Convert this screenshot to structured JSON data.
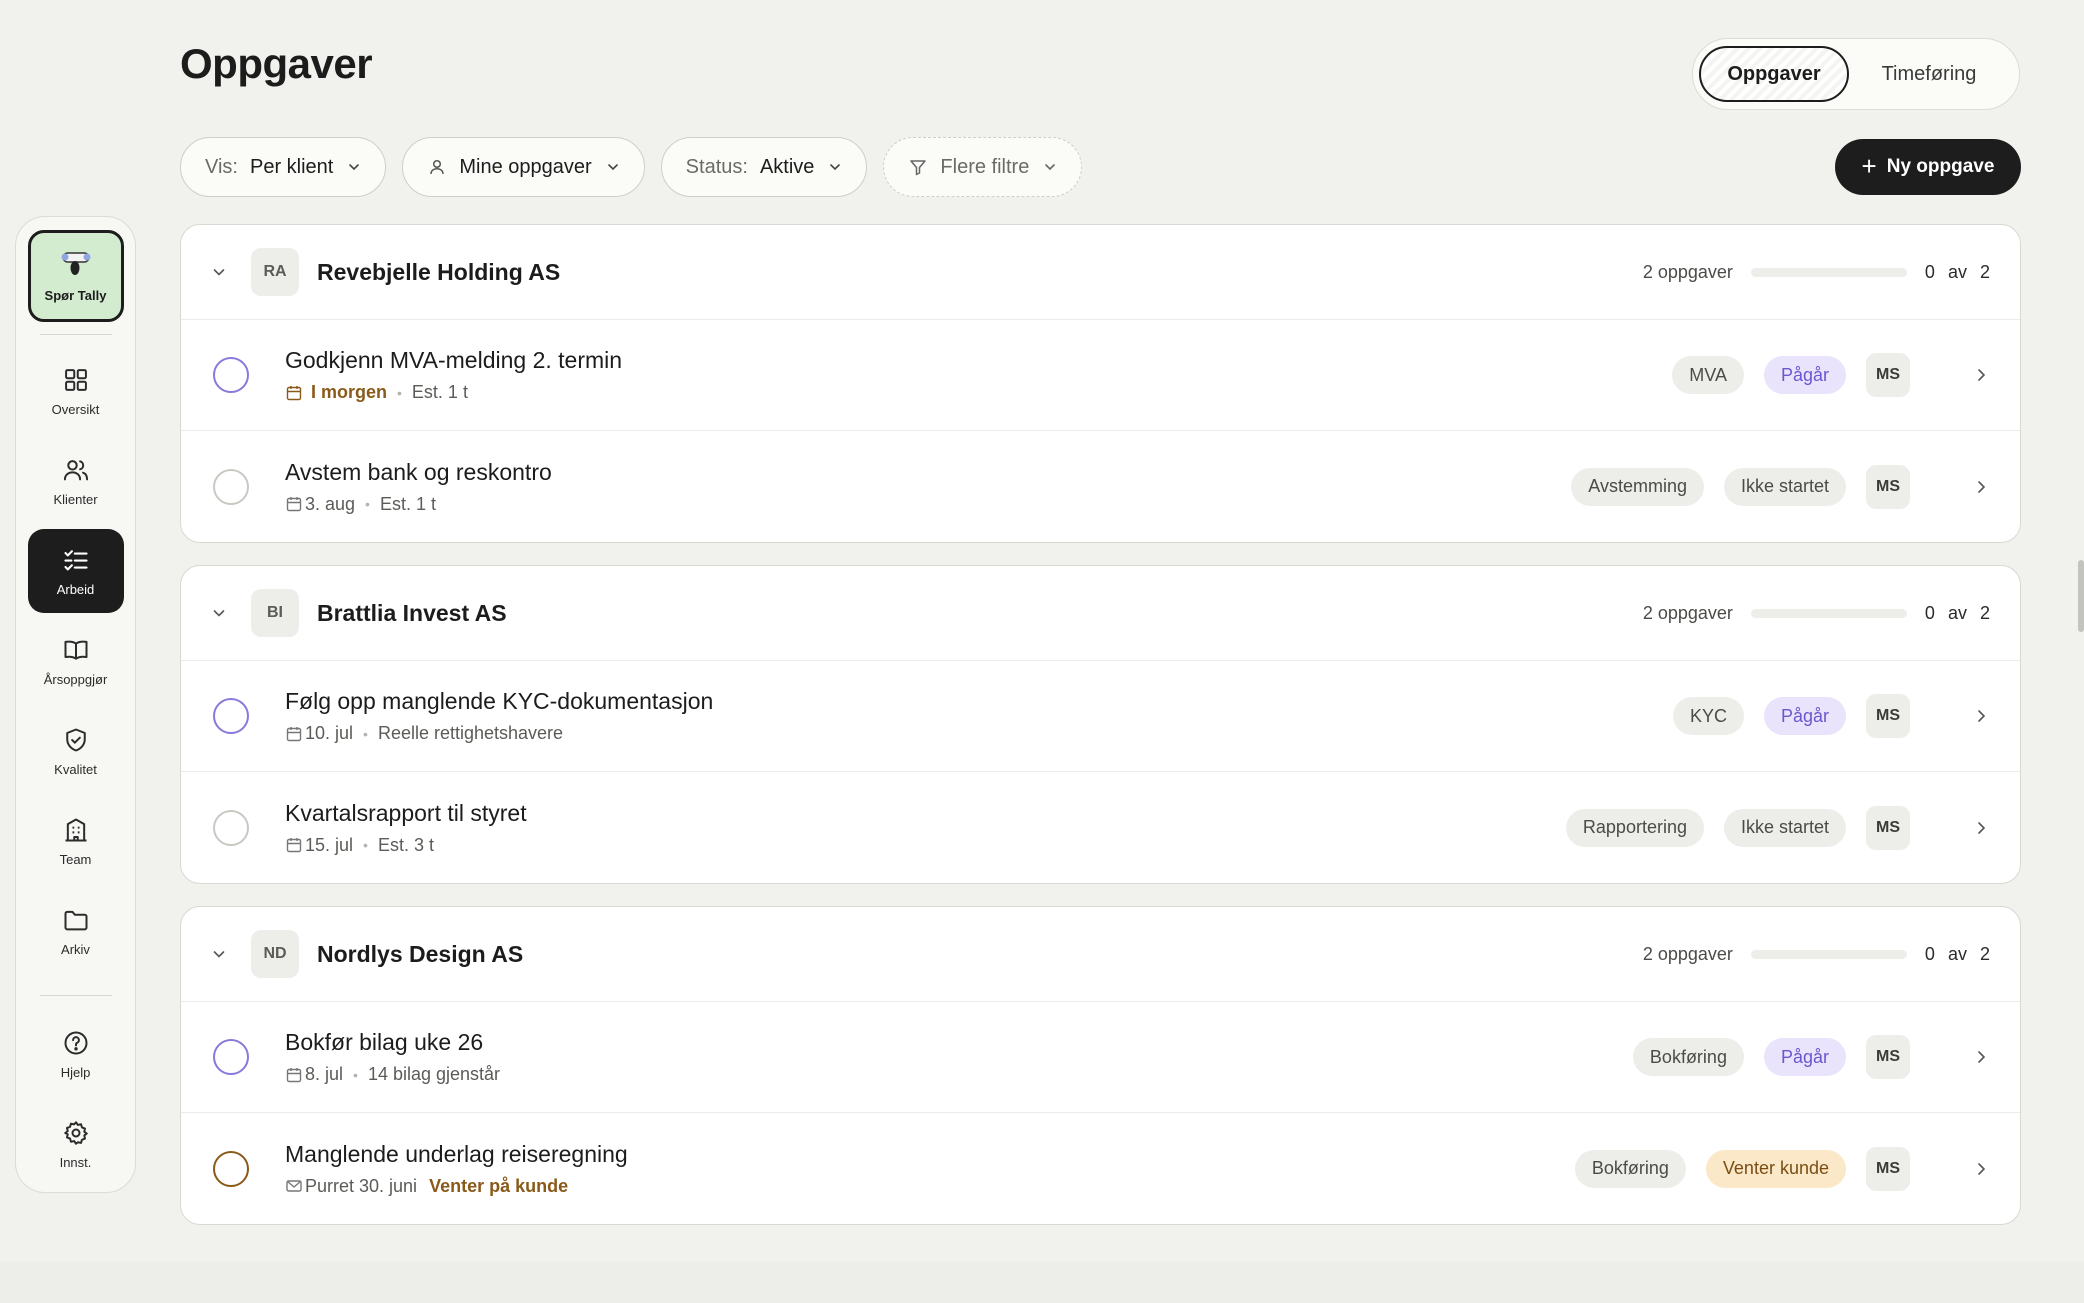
{
  "title": "Oppgaver",
  "view_toggle": {
    "selected": "Oppgaver",
    "other": "Timeføring"
  },
  "filters": {
    "vis_label": "Vis:",
    "vis_value": "Per klient",
    "mine": "Mine oppgaver",
    "status_label": "Status:",
    "status_value": "Aktive",
    "more": "Flere filtre"
  },
  "new_task": "Ny oppgave",
  "sidebar": {
    "ask": "Spør Tally",
    "items": [
      {
        "label": "Oversikt",
        "icon": "grid-icon"
      },
      {
        "label": "Klienter",
        "icon": "users-icon"
      },
      {
        "label": "Arbeid",
        "icon": "checklist-icon"
      },
      {
        "label": "Årsoppgjør",
        "icon": "book-icon"
      },
      {
        "label": "Kvalitet",
        "icon": "shield-check-icon"
      },
      {
        "label": "Team",
        "icon": "building-icon"
      },
      {
        "label": "Arkiv",
        "icon": "folder-icon"
      }
    ],
    "bottom": [
      {
        "label": "Hjelp",
        "icon": "help-icon"
      },
      {
        "label": "Innst.",
        "icon": "gear-icon"
      }
    ]
  },
  "groups": [
    {
      "initials": "RA",
      "name": "Revebjelle Holding AS",
      "count": "2 oppgaver",
      "done": "0",
      "of": "av",
      "total": "2",
      "progress": 0,
      "tasks": [
        {
          "title": "Godkjenn MVA-melding 2. termin",
          "due": "I morgen",
          "extra": "Est. 1 t",
          "tags": [
            "MVA",
            "Pågår"
          ],
          "assignee": "MS"
        },
        {
          "title": "Avstem bank og reskontro",
          "due": "3. aug",
          "extra": "Est. 1 t",
          "tags": [
            "Avstemming",
            "Ikke startet"
          ],
          "assignee": "MS"
        }
      ]
    },
    {
      "initials": "BI",
      "name": "Brattlia Invest AS",
      "count": "2 oppgaver",
      "done": "0",
      "of": "av",
      "total": "2",
      "progress": 0,
      "tasks": [
        {
          "title": "Følg opp manglende KYC-dokumentasjon",
          "due": "10. jul",
          "extra": "Reelle rettighetshavere",
          "tags": [
            "KYC",
            "Pågår"
          ],
          "assignee": "MS"
        },
        {
          "title": "Kvartalsrapport til styret",
          "due": "15. jul",
          "extra": "Est. 3 t",
          "tags": [
            "Rapportering",
            "Ikke startet"
          ],
          "assignee": "MS"
        }
      ]
    },
    {
      "initials": "ND",
      "name": "Nordlys Design AS",
      "count": "2 oppgaver",
      "done": "0",
      "of": "av",
      "total": "2",
      "progress": 0,
      "tasks": [
        {
          "title": "Bokfør bilag uke 26",
          "due": "8. jul",
          "extra": "14 bilag gjenstår",
          "tags": [
            "Bokføring",
            "Pågår"
          ],
          "assignee": "MS"
        },
        {
          "title": "Manglende underlag reiseregning",
          "due": "Purret 30. juni",
          "extra": "Venter på kunde",
          "tags": [
            "Bokføring",
            "Venter kunde"
          ],
          "assignee": "MS"
        }
      ]
    }
  ],
  "colors": {
    "accent_active": "#6e56cf",
    "waiting": "#8a5a1a",
    "dark": "#1d1d1d",
    "ask_bg": "#d3ecd0"
  }
}
